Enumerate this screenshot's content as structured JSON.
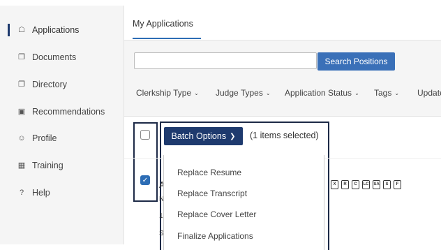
{
  "sidebar": {
    "items": [
      {
        "label": "Applications",
        "icon": "briefcase-icon",
        "glyph": "☖"
      },
      {
        "label": "Documents",
        "icon": "documents-icon",
        "glyph": "❐"
      },
      {
        "label": "Directory",
        "icon": "folder-icon",
        "glyph": "❐"
      },
      {
        "label": "Recommendations",
        "icon": "letter-icon",
        "glyph": "▣"
      },
      {
        "label": "Profile",
        "icon": "person-icon",
        "glyph": "☺"
      },
      {
        "label": "Training",
        "icon": "calendar-icon",
        "glyph": "▦"
      },
      {
        "label": "Help",
        "icon": "help-icon",
        "glyph": "?"
      }
    ]
  },
  "tabs": {
    "active": "My Applications"
  },
  "search": {
    "placeholder": "",
    "button": "Search Positions"
  },
  "filters": [
    "Clerkship Type",
    "Judge Types",
    "Application Status",
    "Tags",
    "Update"
  ],
  "batch": {
    "button": "Batch Options",
    "selected": "(1 items selected)"
  },
  "batch_menu": [
    "Replace Resume",
    "Replace Transcript",
    "Replace Cover Letter",
    "Finalize Applications"
  ],
  "row": {
    "partial_a": "A",
    "partial_b": "N",
    "partial_c": "1",
    "partial_d": "S"
  },
  "doc_icons": [
    "X",
    "R",
    "C",
    "LC",
    "SA",
    "S",
    "F"
  ]
}
